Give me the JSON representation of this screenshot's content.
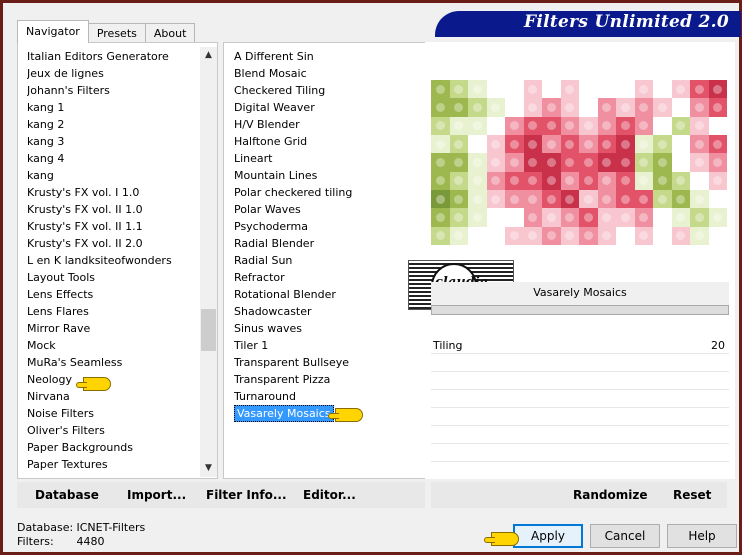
{
  "tabs": [
    {
      "label": "Navigator",
      "active": true
    },
    {
      "label": "Presets",
      "active": false
    },
    {
      "label": "About",
      "active": false
    }
  ],
  "banner": {
    "title": "Filters Unlimited 2.0"
  },
  "categories": [
    "Italian Editors Generatore",
    "Jeux de lignes",
    "Johann's Filters",
    "kang 1",
    "kang 2",
    "kang 3",
    "kang 4",
    "kang",
    "Krusty's FX vol. I 1.0",
    "Krusty's FX vol. II 1.0",
    "Krusty's FX vol. II 1.1",
    "Krusty's FX vol. II 2.0",
    "L en K landksiteofwonders",
    "Layout Tools",
    "Lens Effects",
    "Lens Flares",
    "Mirror Rave",
    "Mock",
    "MuRa's Seamless",
    "Neology",
    "Nirvana",
    "Noise Filters",
    "Oliver's Filters",
    "Paper Backgrounds",
    "Paper Textures"
  ],
  "filters": [
    "A Different Sin",
    "Blend Mosaic",
    "Checkered Tiling",
    "Digital Weaver",
    "H/V Blender",
    "Halftone Grid",
    "Lineart",
    "Mountain Lines",
    "Polar checkered tiling",
    "Polar Waves",
    "Psychoderma",
    "Radial Blender",
    "Radial Sun",
    "Refractor",
    "Rotational Blender",
    "Shadowcaster",
    "Sinus waves",
    "Tiler 1",
    "Transparent Bullseye",
    "Transparent Pizza",
    "Turnaround",
    "Vasarely Mosaics"
  ],
  "selected_filter": "Vasarely Mosaics",
  "watermark_text": "claudia",
  "params": [
    {
      "label": "Tiling",
      "value": "20"
    }
  ],
  "left_buttons": {
    "database": "Database",
    "import": "Import...",
    "filter_info": "Filter Info...",
    "editor": "Editor..."
  },
  "right_buttons": {
    "randomize": "Randomize",
    "reset": "Reset"
  },
  "status": {
    "database_label": "Database:",
    "database_value": "ICNET-Filters",
    "filters_label": "Filters:",
    "filters_value": "4480"
  },
  "dialog_buttons": {
    "apply": "Apply",
    "cancel": "Cancel",
    "help": "Help"
  },
  "colors": {
    "banner": "#0a1a8c",
    "frame": "#6b1e18",
    "selection": "#3399ff",
    "pointer": "#ffd400"
  },
  "preview_palette": [
    "#7a9a3a",
    "#9cb84e",
    "#c4d98a",
    "#e8f2d0",
    "#ffffff",
    "#f7c6cf",
    "#ef8fa0",
    "#e2536a",
    "#c9304a"
  ],
  "preview_grid": [
    [
      1,
      2,
      3,
      4,
      4,
      5,
      4,
      5,
      4,
      4,
      4,
      5,
      4,
      5,
      7,
      8
    ],
    [
      1,
      1,
      2,
      3,
      4,
      5,
      6,
      5,
      4,
      6,
      5,
      6,
      5,
      4,
      6,
      7
    ],
    [
      2,
      3,
      3,
      4,
      6,
      7,
      7,
      6,
      5,
      6,
      7,
      6,
      4,
      2,
      5,
      4
    ],
    [
      3,
      2,
      4,
      5,
      7,
      8,
      6,
      7,
      6,
      7,
      8,
      3,
      2,
      4,
      6,
      7
    ],
    [
      1,
      1,
      3,
      5,
      6,
      8,
      8,
      7,
      7,
      8,
      8,
      2,
      1,
      4,
      5,
      6
    ],
    [
      1,
      2,
      3,
      6,
      7,
      7,
      8,
      6,
      7,
      6,
      7,
      3,
      1,
      2,
      4,
      5
    ],
    [
      0,
      1,
      3,
      5,
      6,
      6,
      7,
      8,
      5,
      6,
      7,
      7,
      2,
      1,
      3,
      4
    ],
    [
      1,
      2,
      3,
      4,
      4,
      6,
      5,
      6,
      7,
      5,
      5,
      6,
      4,
      3,
      2,
      3
    ],
    [
      2,
      3,
      4,
      4,
      5,
      5,
      6,
      5,
      6,
      5,
      4,
      5,
      4,
      5,
      3,
      4
    ]
  ]
}
